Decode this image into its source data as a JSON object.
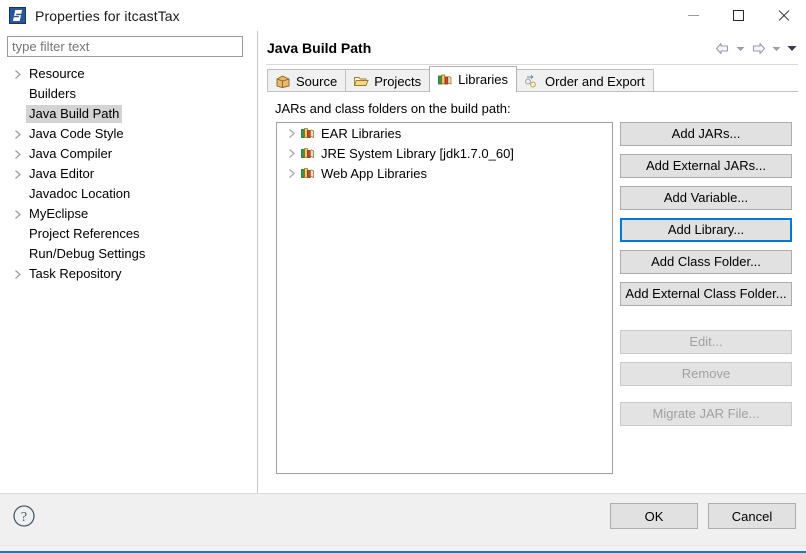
{
  "window": {
    "title": "Properties for itcastTax",
    "icon": "eclipse-properties-icon",
    "controls": {
      "minimize": "minimize-icon",
      "maximize": "maximize-icon",
      "close": "close-icon"
    }
  },
  "sidebar": {
    "filter": {
      "value": "",
      "placeholder": "type filter text"
    },
    "items": [
      {
        "label": "Resource",
        "expandable": true,
        "selected": false
      },
      {
        "label": "Builders",
        "expandable": false,
        "selected": false
      },
      {
        "label": "Java Build Path",
        "expandable": false,
        "selected": true
      },
      {
        "label": "Java Code Style",
        "expandable": true,
        "selected": false
      },
      {
        "label": "Java Compiler",
        "expandable": true,
        "selected": false
      },
      {
        "label": "Java Editor",
        "expandable": true,
        "selected": false
      },
      {
        "label": "Javadoc Location",
        "expandable": false,
        "selected": false
      },
      {
        "label": "MyEclipse",
        "expandable": true,
        "selected": false
      },
      {
        "label": "Project References",
        "expandable": false,
        "selected": false
      },
      {
        "label": "Run/Debug Settings",
        "expandable": false,
        "selected": false
      },
      {
        "label": "Task Repository",
        "expandable": true,
        "selected": false
      }
    ]
  },
  "page": {
    "title": "Java Build Path",
    "nav": {
      "back": "back-arrow-icon",
      "back_menu": "chevron-down-icon",
      "forward": "forward-arrow-icon",
      "forward_menu": "chevron-down-icon",
      "view_menu": "chevron-down-icon"
    },
    "tabs": [
      {
        "label": "Source",
        "icon": "source-package-icon",
        "active": false
      },
      {
        "label": "Projects",
        "icon": "folder-icon",
        "active": false
      },
      {
        "label": "Libraries",
        "icon": "library-books-icon",
        "active": true
      },
      {
        "label": "Order and Export",
        "icon": "order-export-icon",
        "active": false
      }
    ],
    "content_label": "JARs and class folders on the build path:",
    "libraries": [
      {
        "label": "EAR Libraries",
        "icon": "library-books-icon",
        "expandable": true
      },
      {
        "label": "JRE System Library [jdk1.7.0_60]",
        "icon": "library-books-icon",
        "expandable": true
      },
      {
        "label": "Web App Libraries",
        "icon": "library-books-icon",
        "expandable": true
      }
    ],
    "buttons": [
      {
        "label": "Add JARs...",
        "enabled": true,
        "focused": false
      },
      {
        "label": "Add External JARs...",
        "enabled": true,
        "focused": false
      },
      {
        "label": "Add Variable...",
        "enabled": true,
        "focused": false
      },
      {
        "label": "Add Library...",
        "enabled": true,
        "focused": true
      },
      {
        "label": "Add Class Folder...",
        "enabled": true,
        "focused": false
      },
      {
        "label": "Add External Class Folder...",
        "enabled": true,
        "focused": false
      },
      {
        "label": "Edit...",
        "enabled": false,
        "focused": false
      },
      {
        "label": "Remove",
        "enabled": false,
        "focused": false
      },
      {
        "label": "Migrate JAR File...",
        "enabled": false,
        "focused": false
      }
    ]
  },
  "footer": {
    "help": "help-icon",
    "ok_label": "OK",
    "cancel_label": "Cancel"
  },
  "colors": {
    "focus_blue": "#0078d7",
    "selection_gray": "#d3d3d3",
    "button_face": "#e1e1e1",
    "disabled_text": "#a0a0a0",
    "footer_bg": "#f0f0f0"
  }
}
